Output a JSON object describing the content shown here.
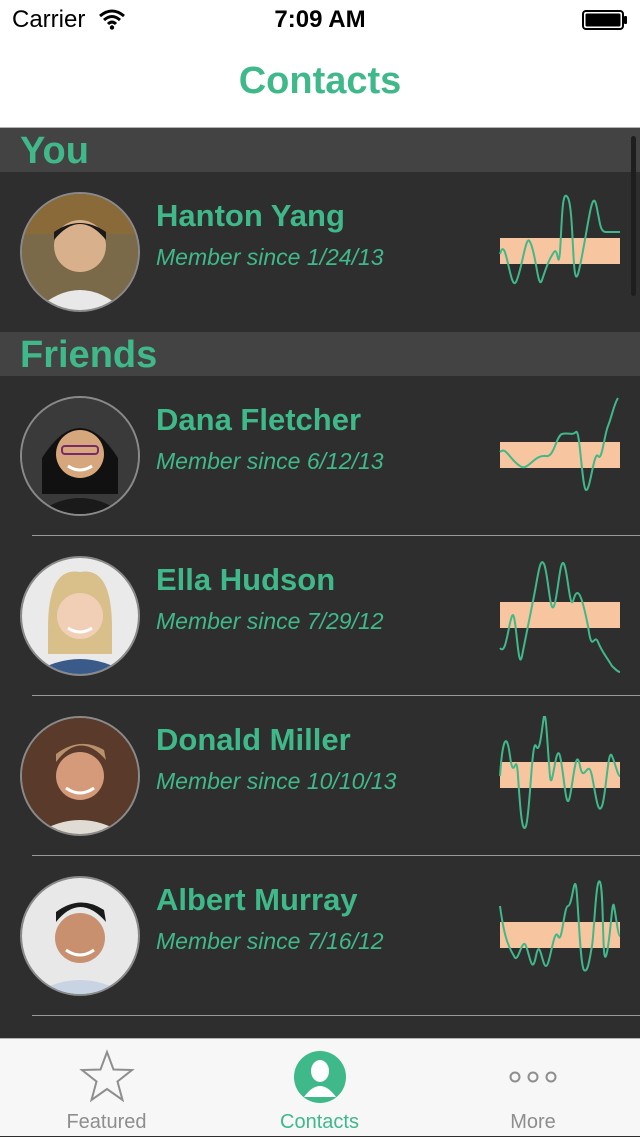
{
  "status_bar": {
    "carrier": "Carrier",
    "time": "7:09 AM"
  },
  "nav": {
    "title": "Contacts"
  },
  "colors": {
    "accent": "#3fb98a",
    "band": "#f7c59f",
    "background": "#2e2e2e"
  },
  "sections": [
    {
      "title": "You"
    },
    {
      "title": "Friends"
    }
  ],
  "contacts": [
    {
      "name": "Hanton Yang",
      "subtitle": "Member since 1/24/13",
      "avatar": "person-photo"
    },
    {
      "name": "Dana Fletcher",
      "subtitle": "Member since 6/12/13",
      "avatar": "person-photo"
    },
    {
      "name": "Ella Hudson",
      "subtitle": "Member since 7/29/12",
      "avatar": "person-photo"
    },
    {
      "name": "Donald Miller",
      "subtitle": "Member since 10/10/13",
      "avatar": "person-photo"
    },
    {
      "name": "Albert Murray",
      "subtitle": "Member since 7/16/12",
      "avatar": "person-photo"
    }
  ],
  "tabs": [
    {
      "label": "Featured",
      "icon": "star-icon"
    },
    {
      "label": "Contacts",
      "icon": "contact-icon",
      "active": true
    },
    {
      "label": "More",
      "icon": "more-icon"
    }
  ]
}
